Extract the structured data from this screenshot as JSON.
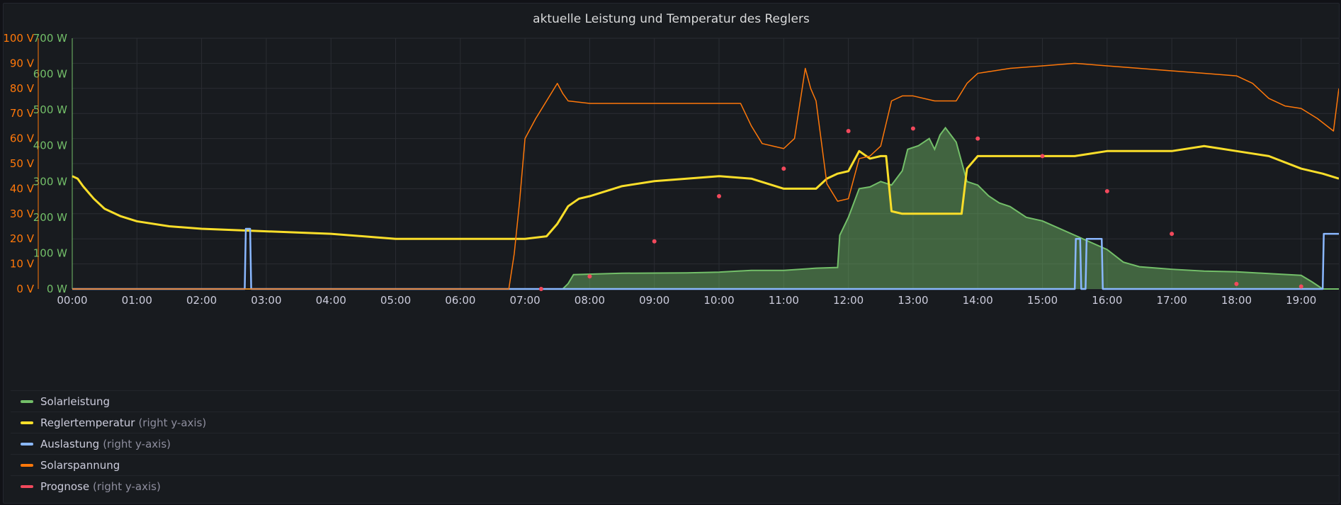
{
  "panel": {
    "title": "aktuelle Leistung und Temperatur des Reglers"
  },
  "colors": {
    "background": "#181b1f",
    "grid": "#2a2d33",
    "green": "#73bf69",
    "yellow": "#fade2a",
    "blue": "#8ab8ff",
    "orange": "#ff780a",
    "red": "#f2495c"
  },
  "legend": [
    {
      "label": "Solarleistung",
      "note": "",
      "color": "#73bf69"
    },
    {
      "label": "Reglertemperatur",
      "note": "(right y-axis)",
      "color": "#fade2a"
    },
    {
      "label": "Auslastung",
      "note": "(right y-axis)",
      "color": "#8ab8ff"
    },
    {
      "label": "Solarspannung",
      "note": "",
      "color": "#ff780a"
    },
    {
      "label": "Prognose",
      "note": "(right y-axis)",
      "color": "#f2495c"
    }
  ],
  "chart_data": {
    "type": "line",
    "title": "aktuelle Leistung und Temperatur des Reglers",
    "x_ticks": [
      "00:00",
      "01:00",
      "02:00",
      "03:00",
      "04:00",
      "05:00",
      "06:00",
      "07:00",
      "08:00",
      "09:00",
      "10:00",
      "11:00",
      "12:00",
      "13:00",
      "14:00",
      "15:00",
      "16:00",
      "17:00",
      "18:00",
      "19:00"
    ],
    "xlim": [
      "00:00",
      "19:35"
    ],
    "y_axis_voltage": {
      "ticks": [
        "0 V",
        "10 V",
        "20 V",
        "30 V",
        "40 V",
        "50 V",
        "60 V",
        "70 V",
        "80 V",
        "90 V",
        "100 V"
      ],
      "ylim": [
        0,
        100
      ],
      "unit": "V"
    },
    "y_axis_power": {
      "ticks": [
        "0 W",
        "100 W",
        "200 W",
        "300 W",
        "400 W",
        "500 W",
        "600 W",
        "700 W"
      ],
      "ylim": [
        0,
        700
      ],
      "unit": "W"
    },
    "series": [
      {
        "name": "Solarleistung",
        "axis": "power",
        "style": "area",
        "points": [
          [
            "00:00",
            0
          ],
          [
            "07:35",
            0
          ],
          [
            "07:40",
            15
          ],
          [
            "07:45",
            40
          ],
          [
            "08:30",
            44
          ],
          [
            "09:30",
            45
          ],
          [
            "10:00",
            47
          ],
          [
            "10:30",
            52
          ],
          [
            "11:00",
            52
          ],
          [
            "11:30",
            58
          ],
          [
            "11:50",
            60
          ],
          [
            "11:52",
            150
          ],
          [
            "12:00",
            200
          ],
          [
            "12:10",
            280
          ],
          [
            "12:20",
            285
          ],
          [
            "12:30",
            300
          ],
          [
            "12:40",
            290
          ],
          [
            "12:50",
            330
          ],
          [
            "12:55",
            390
          ],
          [
            "13:05",
            400
          ],
          [
            "13:15",
            420
          ],
          [
            "13:20",
            390
          ],
          [
            "13:25",
            430
          ],
          [
            "13:30",
            450
          ],
          [
            "13:40",
            410
          ],
          [
            "13:50",
            300
          ],
          [
            "14:00",
            290
          ],
          [
            "14:10",
            260
          ],
          [
            "14:20",
            240
          ],
          [
            "14:30",
            230
          ],
          [
            "14:45",
            200
          ],
          [
            "15:00",
            190
          ],
          [
            "15:15",
            170
          ],
          [
            "15:30",
            150
          ],
          [
            "15:45",
            130
          ],
          [
            "16:00",
            110
          ],
          [
            "16:15",
            75
          ],
          [
            "16:30",
            62
          ],
          [
            "17:00",
            55
          ],
          [
            "17:30",
            50
          ],
          [
            "18:00",
            48
          ],
          [
            "18:30",
            43
          ],
          [
            "19:00",
            38
          ],
          [
            "19:10",
            20
          ],
          [
            "19:20",
            0
          ],
          [
            "19:35",
            0
          ]
        ]
      },
      {
        "name": "Reglertemperatur",
        "axis": "voltage",
        "style": "line",
        "points": [
          [
            "00:00",
            45
          ],
          [
            "00:05",
            44
          ],
          [
            "00:10",
            41
          ],
          [
            "00:20",
            36
          ],
          [
            "00:30",
            32
          ],
          [
            "00:45",
            29
          ],
          [
            "01:00",
            27
          ],
          [
            "01:30",
            25
          ],
          [
            "02:00",
            24
          ],
          [
            "03:00",
            23
          ],
          [
            "04:00",
            22
          ],
          [
            "05:00",
            20
          ],
          [
            "06:00",
            20
          ],
          [
            "07:00",
            20
          ],
          [
            "07:20",
            21
          ],
          [
            "07:30",
            26
          ],
          [
            "07:40",
            33
          ],
          [
            "07:50",
            36
          ],
          [
            "08:00",
            37
          ],
          [
            "08:15",
            39
          ],
          [
            "08:30",
            41
          ],
          [
            "09:00",
            43
          ],
          [
            "09:30",
            44
          ],
          [
            "10:00",
            45
          ],
          [
            "10:30",
            44
          ],
          [
            "10:45",
            42
          ],
          [
            "11:00",
            40
          ],
          [
            "11:30",
            40
          ],
          [
            "11:40",
            44
          ],
          [
            "11:50",
            46
          ],
          [
            "12:00",
            47
          ],
          [
            "12:10",
            55
          ],
          [
            "12:20",
            52
          ],
          [
            "12:30",
            53
          ],
          [
            "12:35",
            53
          ],
          [
            "12:40",
            31
          ],
          [
            "12:50",
            30
          ],
          [
            "13:30",
            30
          ],
          [
            "13:45",
            30
          ],
          [
            "13:50",
            48
          ],
          [
            "14:00",
            53
          ],
          [
            "14:30",
            53
          ],
          [
            "15:00",
            53
          ],
          [
            "15:30",
            53
          ],
          [
            "16:00",
            55
          ],
          [
            "16:30",
            55
          ],
          [
            "17:00",
            55
          ],
          [
            "17:30",
            57
          ],
          [
            "17:45",
            56
          ],
          [
            "18:00",
            55
          ],
          [
            "18:30",
            53
          ],
          [
            "19:00",
            48
          ],
          [
            "19:20",
            46
          ],
          [
            "19:35",
            44
          ]
        ]
      },
      {
        "name": "Auslastung",
        "axis": "voltage",
        "style": "line",
        "points": [
          [
            "00:00",
            0
          ],
          [
            "02:40",
            0
          ],
          [
            "02:41",
            24
          ],
          [
            "02:45",
            24
          ],
          [
            "02:46",
            0
          ],
          [
            "15:30",
            0
          ],
          [
            "15:31",
            20
          ],
          [
            "15:35",
            20
          ],
          [
            "15:36",
            0
          ],
          [
            "15:40",
            0
          ],
          [
            "15:41",
            20
          ],
          [
            "15:55",
            20
          ],
          [
            "15:56",
            0
          ],
          [
            "19:20",
            0
          ],
          [
            "19:21",
            22
          ],
          [
            "19:35",
            22
          ]
        ]
      },
      {
        "name": "Solarspannung",
        "axis": "voltage",
        "style": "line",
        "points": [
          [
            "00:00",
            0
          ],
          [
            "06:45",
            0
          ],
          [
            "06:50",
            14
          ],
          [
            "06:55",
            35
          ],
          [
            "07:00",
            60
          ],
          [
            "07:10",
            68
          ],
          [
            "07:20",
            75
          ],
          [
            "07:30",
            82
          ],
          [
            "07:35",
            78
          ],
          [
            "07:40",
            75
          ],
          [
            "08:00",
            74
          ],
          [
            "09:00",
            74
          ],
          [
            "10:00",
            74
          ],
          [
            "10:20",
            74
          ],
          [
            "10:30",
            65
          ],
          [
            "10:40",
            58
          ],
          [
            "10:50",
            57
          ],
          [
            "11:00",
            56
          ],
          [
            "11:10",
            60
          ],
          [
            "11:20",
            88
          ],
          [
            "11:25",
            80
          ],
          [
            "11:30",
            75
          ],
          [
            "11:40",
            42
          ],
          [
            "11:50",
            35
          ],
          [
            "12:00",
            36
          ],
          [
            "12:10",
            52
          ],
          [
            "12:20",
            53
          ],
          [
            "12:30",
            57
          ],
          [
            "12:40",
            75
          ],
          [
            "12:50",
            77
          ],
          [
            "13:00",
            77
          ],
          [
            "13:20",
            75
          ],
          [
            "13:40",
            75
          ],
          [
            "13:50",
            82
          ],
          [
            "14:00",
            86
          ],
          [
            "14:30",
            88
          ],
          [
            "15:00",
            89
          ],
          [
            "15:30",
            90
          ],
          [
            "16:00",
            89
          ],
          [
            "16:30",
            88
          ],
          [
            "17:00",
            87
          ],
          [
            "17:30",
            86
          ],
          [
            "18:00",
            85
          ],
          [
            "18:15",
            82
          ],
          [
            "18:30",
            76
          ],
          [
            "18:45",
            73
          ],
          [
            "19:00",
            72
          ],
          [
            "19:15",
            68
          ],
          [
            "19:30",
            63
          ],
          [
            "19:35",
            80
          ]
        ]
      },
      {
        "name": "Prognose",
        "axis": "voltage",
        "style": "points",
        "points": [
          [
            "07:15",
            0
          ],
          [
            "08:00",
            5
          ],
          [
            "09:00",
            19
          ],
          [
            "10:00",
            37
          ],
          [
            "11:00",
            48
          ],
          [
            "12:00",
            63
          ],
          [
            "13:00",
            64
          ],
          [
            "14:00",
            60
          ],
          [
            "15:00",
            53
          ],
          [
            "16:00",
            39
          ],
          [
            "17:00",
            22
          ],
          [
            "18:00",
            2
          ],
          [
            "19:00",
            1
          ]
        ]
      }
    ]
  }
}
